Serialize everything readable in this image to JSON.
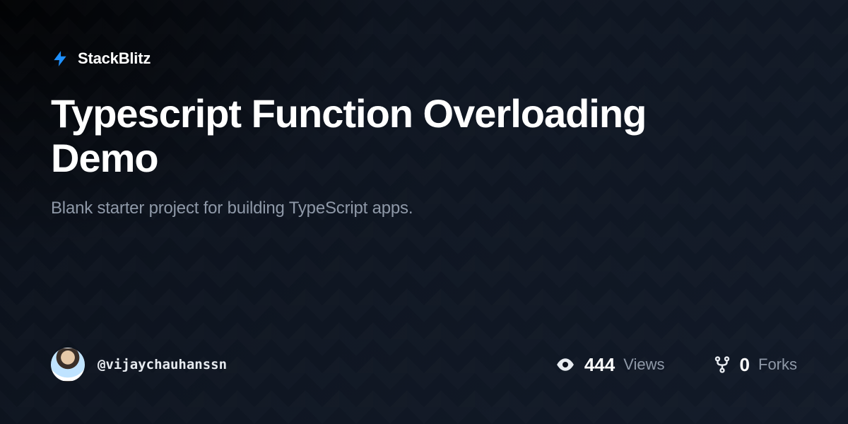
{
  "brand": {
    "name": "StackBlitz"
  },
  "project": {
    "title": "Typescript Function Overloading Demo",
    "description": "Blank starter project for building TypeScript apps."
  },
  "author": {
    "handle": "@vijaychauhanssn"
  },
  "stats": {
    "views": {
      "count": "444",
      "label": "Views"
    },
    "forks": {
      "count": "0",
      "label": "Forks"
    }
  },
  "colors": {
    "accent": "#1E90FF"
  }
}
